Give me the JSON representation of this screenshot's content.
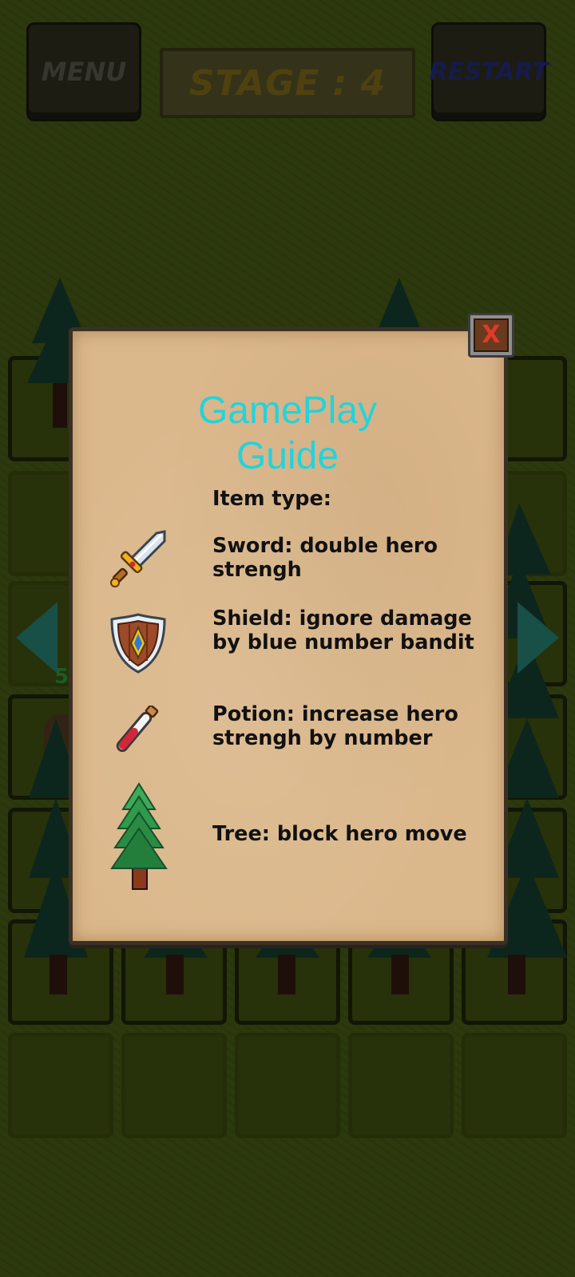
{
  "header": {
    "menu_label": "MENU",
    "stage_label": "STAGE : 4",
    "restart_label": "RESTART"
  },
  "board": {
    "hidden_number": "5"
  },
  "guide": {
    "title_line1": "GamePlay",
    "title_line2": "Guide",
    "close_label": "X",
    "item_type_label": "Item type:",
    "items": [
      {
        "icon": "sword-icon",
        "text": "Sword: double hero strengh"
      },
      {
        "icon": "shield-icon",
        "text": "Shield: ignore damage by blue number bandit"
      },
      {
        "icon": "potion-icon",
        "text": "Potion: increase hero strengh by number"
      },
      {
        "icon": "tree-icon",
        "text": "Tree: block hero move"
      }
    ]
  },
  "colors": {
    "title": "#22d3dc",
    "parchment": "#dbb88c",
    "close_x": "#e03a2a",
    "nav_arrow": "#1c5a50"
  }
}
